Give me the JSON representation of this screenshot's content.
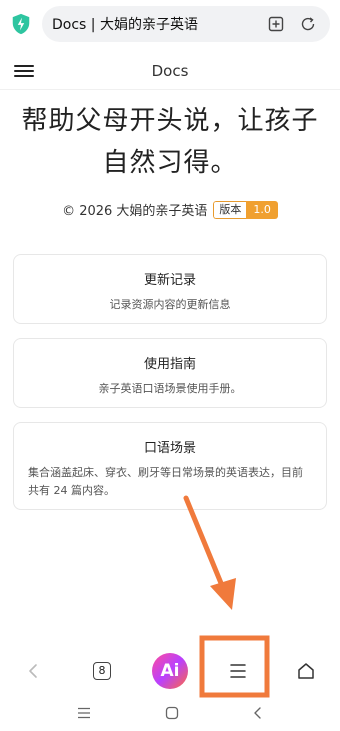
{
  "browser": {
    "url_text": "Docs | 大娟的亲子英语"
  },
  "header": {
    "title": "Docs"
  },
  "hero": {
    "tagline": "帮助父母开头说，让孩子自然习得。",
    "copyright": "© 2026 大娟的亲子英语",
    "badge_label": "版本",
    "badge_value": "1.0"
  },
  "cards": [
    {
      "title": "更新记录",
      "desc": "记录资源内容的更新信息"
    },
    {
      "title": "使用指南",
      "desc": "亲子英语口语场景使用手册。"
    },
    {
      "title": "口语场景",
      "desc": "集合涵盖起床、穿衣、刷牙等日常场景的英语表达，目前共有 24 篇内容。"
    }
  ],
  "toolbar": {
    "tab_count": "8",
    "ai_label": "Ai"
  },
  "colors": {
    "annotation": "#f07a3c",
    "badge": "#f0a030",
    "shield": "#2ec5a0"
  },
  "icons": [
    "shield-icon",
    "add-bookmark-icon",
    "refresh-icon",
    "hamburger-icon",
    "back-icon",
    "tabs-icon",
    "ai-icon",
    "menu-icon",
    "home-icon"
  ]
}
